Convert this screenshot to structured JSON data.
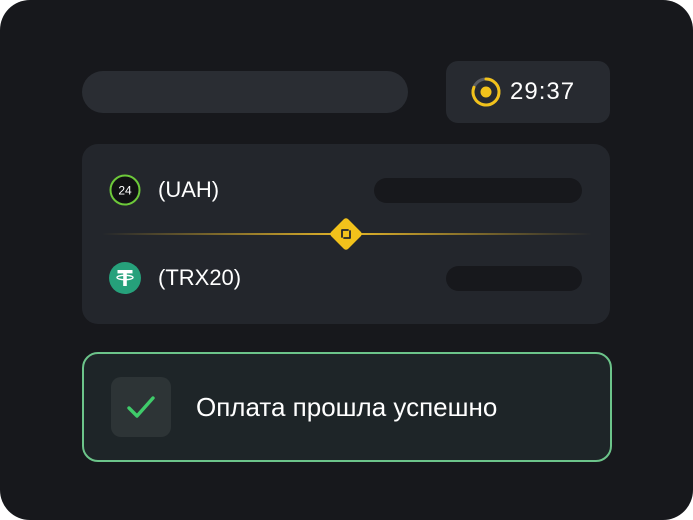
{
  "timer": {
    "value": "29:37",
    "icon": "timer-ring-icon",
    "accent_color": "#f2c21b"
  },
  "exchange": {
    "from": {
      "currency": "(UAH)",
      "icon": "privat24-icon",
      "icon_text": "24",
      "icon_color": "#6dc93a"
    },
    "to": {
      "currency": "(TRX20)",
      "icon": "tether-icon",
      "icon_color": "#26a17b"
    },
    "swap_icon": "swap-diamond-icon",
    "divider_color": "#e4b52a"
  },
  "status": {
    "message": "Оплата прошла успешно",
    "icon": "checkmark-icon",
    "accent_color": "#6cc48a"
  }
}
